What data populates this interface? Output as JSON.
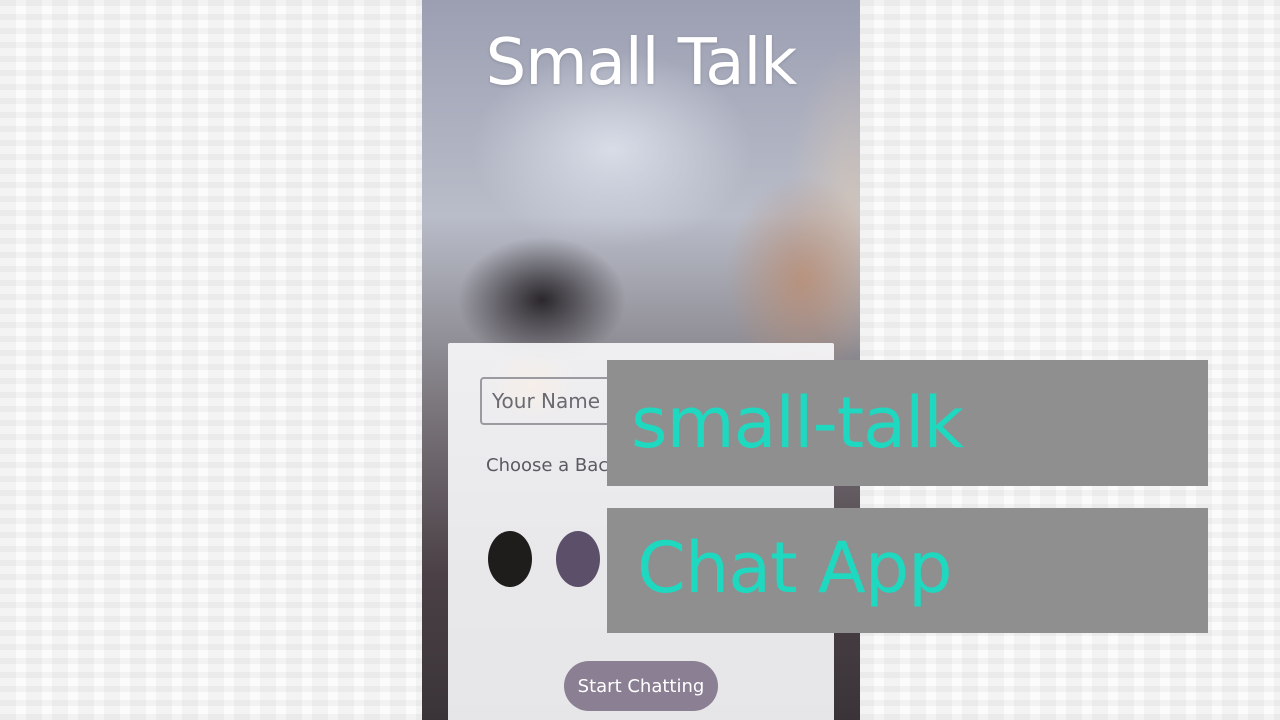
{
  "app": {
    "title": "Small Talk"
  },
  "form": {
    "name_placeholder": "Your Name",
    "background_label": "Choose a Backg",
    "start_button": "Start Chatting"
  },
  "swatches": [
    {
      "color": "#1e1d1c"
    },
    {
      "color": "#5b4f6a"
    }
  ],
  "banners": {
    "line1": "small-talk",
    "line2": "Chat App",
    "background": "#8f8f8f",
    "text_color": "#1ed8c0"
  },
  "colors": {
    "button": "#8a7f93"
  }
}
